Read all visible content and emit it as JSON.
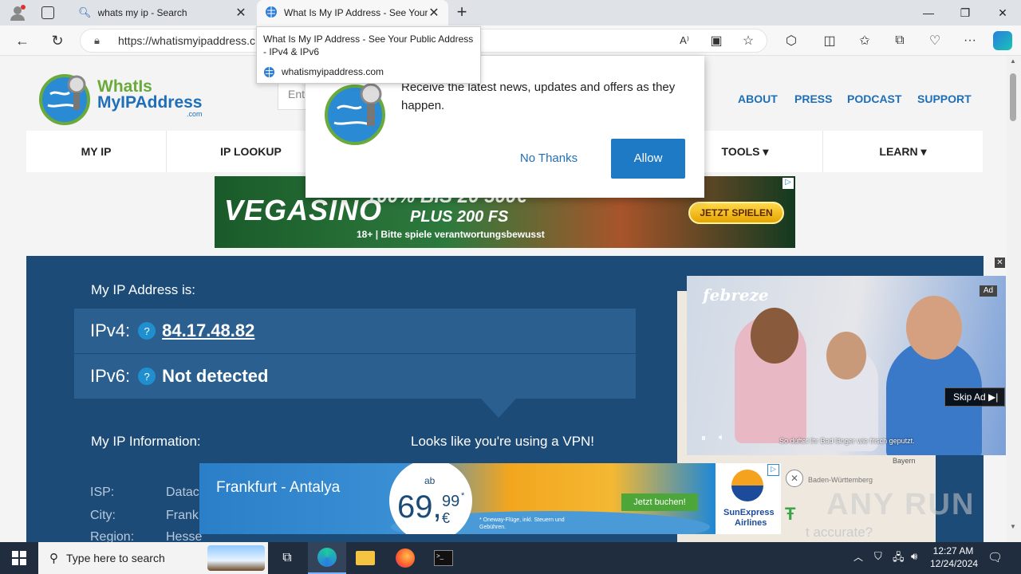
{
  "browser": {
    "tabs": [
      {
        "title": "whats my ip - Search",
        "active": false
      },
      {
        "title": "What Is My IP Address - See Your",
        "active": true
      }
    ],
    "new_tab_label": "+",
    "url": "https://whatismyipaddress.c",
    "tooltip": {
      "title": "What Is My IP Address - See Your Public Address - IPv4 & IPv6",
      "domain": "whatismyipaddress.com"
    }
  },
  "site": {
    "logo": {
      "line1": "WhatIs",
      "line2": "MyIPAddress",
      "line3": ".com"
    },
    "search_placeholder": "Ent",
    "top_links": [
      "ABOUT",
      "PRESS",
      "PODCAST",
      "SUPPORT"
    ],
    "main_nav": [
      "MY IP",
      "IP LOOKUP",
      "TOOLS ▾",
      "LEARN ▾"
    ]
  },
  "notification": {
    "message": "Receive the latest news, updates and offers as they happen.",
    "no_thanks": "No Thanks",
    "allow": "Allow"
  },
  "banner_ad": {
    "brand": "VEGASINO",
    "headline": "100% BIS 20 500€",
    "subline": "PLUS 200 FS",
    "cta": "JETZT SPIELEN",
    "disclaimer": "18+ | Bitte spiele verantwortungsbewusst"
  },
  "ip_info": {
    "heading": "My IP Address is:",
    "ipv4_label": "IPv4:",
    "ipv4_value": "84.17.48.82",
    "ipv6_label": "IPv6:",
    "ipv6_value": "Not detected",
    "info_heading": "My IP Information:",
    "vpn_notice": "Looks like you're using a VPN!",
    "isp_label": "ISP:",
    "isp_value": "Datac",
    "city_label": "City:",
    "city_value": "Frank",
    "region_label": "Region:",
    "region_value": "Hesse",
    "accurate_text": "t accurate?"
  },
  "video_ad": {
    "brand": "febreze",
    "ad_badge": "Ad",
    "skip": "Skip Ad",
    "caption": "So duftet Ihr Bad länger wie frisch geputzt."
  },
  "bottom_ad": {
    "route": "Frankfurt - Antalya",
    "price_prefix": "ab",
    "price_main": "69,",
    "price_cents": "99",
    "price_star": "*",
    "price_currency": "€",
    "fine_print": "* Oneway-Flüge, inkl. Steuern und Gebühren.",
    "cta": "Jetzt buchen!",
    "airline_line1": "SunExpress",
    "airline_line2": "Airlines"
  },
  "map_labels": [
    "Bayern",
    "Baden-Württemberg"
  ],
  "watermark": "ANY RUN",
  "taskbar": {
    "search_placeholder": "Type here to search",
    "time": "12:27 AM",
    "date": "12/24/2024"
  }
}
